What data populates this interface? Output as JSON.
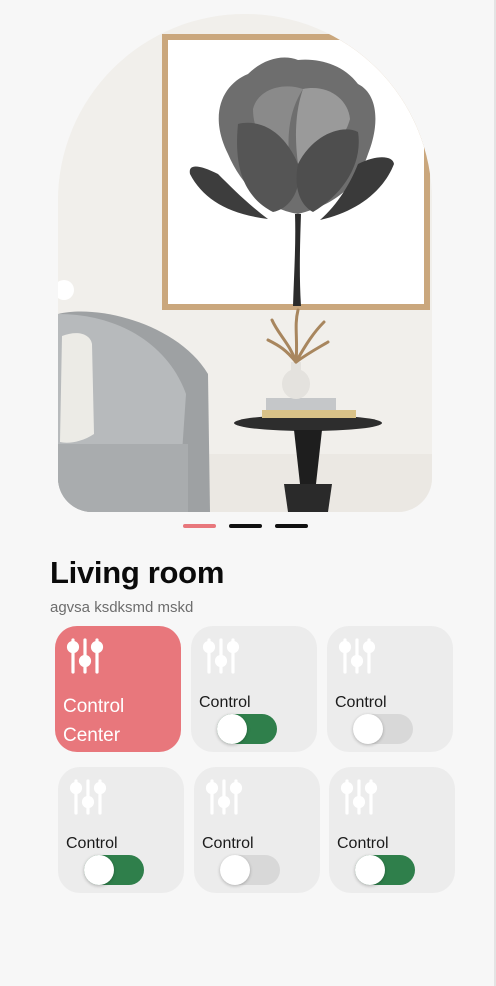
{
  "room": {
    "title": "Living room",
    "subtitle": "agvsa ksdksmd mskd"
  },
  "pager": {
    "count": 3,
    "active_index": 0
  },
  "colors": {
    "accent": "#e8777c",
    "toggle_on": "#2f7f4b",
    "toggle_off": "#d8d8d8",
    "tile_bg": "#ececec"
  },
  "tiles": [
    {
      "label": "Control Center",
      "icon": "sliders-icon",
      "active": true
    },
    {
      "label": "Control",
      "icon": "sliders-icon",
      "toggle": true
    },
    {
      "label": "Control",
      "icon": "sliders-icon",
      "toggle": false
    },
    {
      "label": "Control",
      "icon": "sliders-icon",
      "toggle": true
    },
    {
      "label": "Control",
      "icon": "sliders-icon",
      "toggle": false
    },
    {
      "label": "Control",
      "icon": "sliders-icon",
      "toggle": true
    }
  ]
}
